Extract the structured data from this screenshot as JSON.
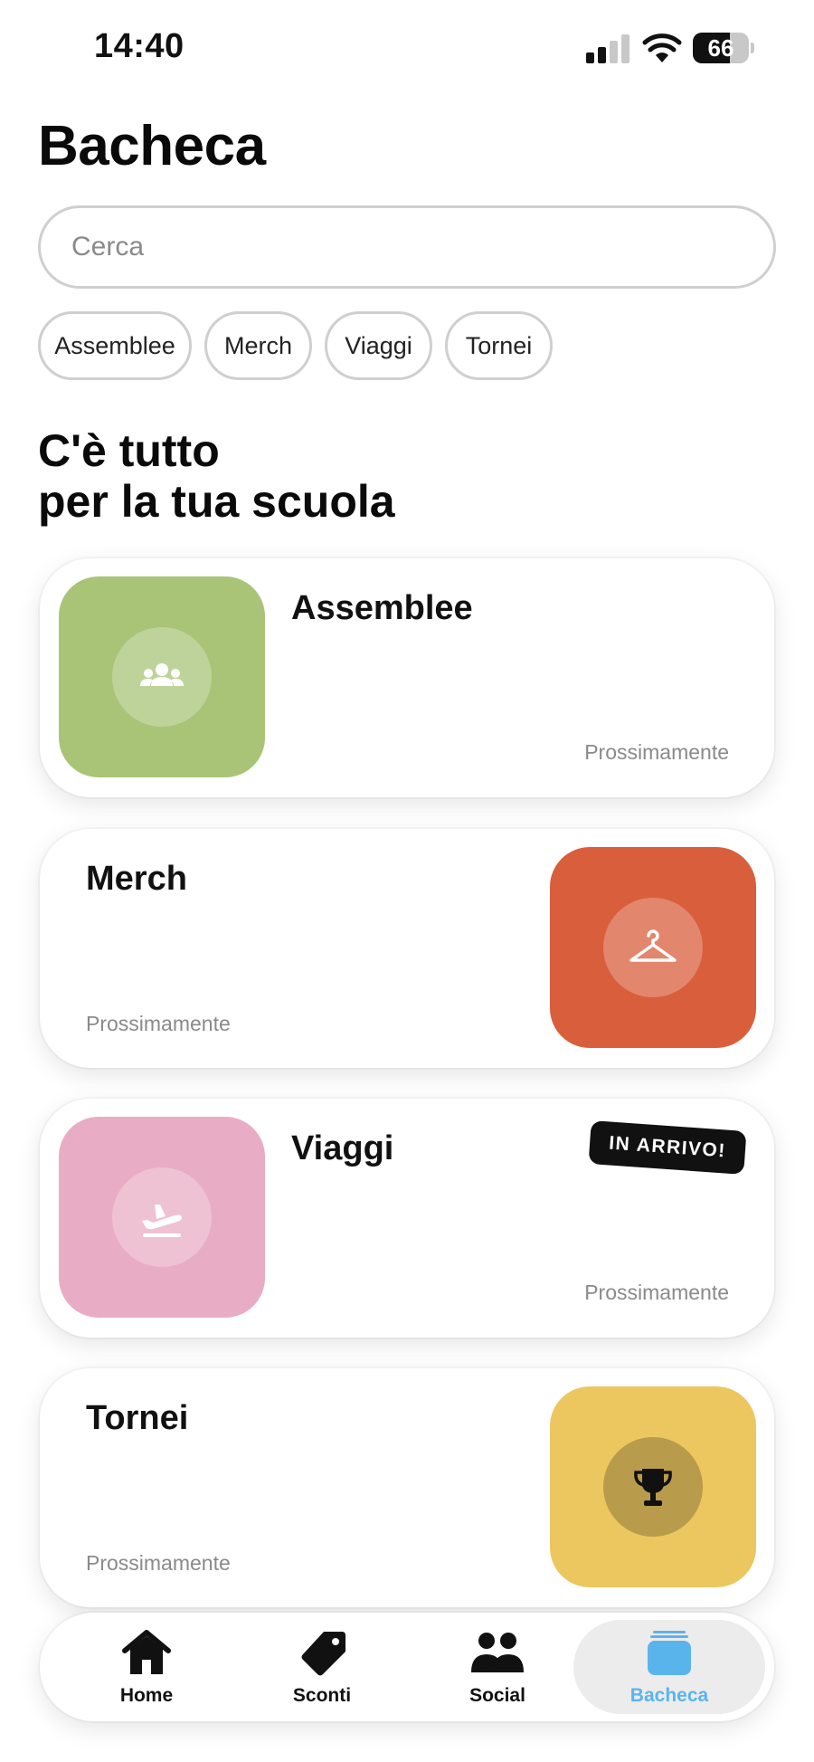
{
  "status_bar": {
    "time": "14:40",
    "battery": "66",
    "battery_level": 0.66
  },
  "header": {
    "title": "Bacheca"
  },
  "search": {
    "placeholder": "Cerca",
    "value": ""
  },
  "chips": [
    {
      "label": "Assemblee"
    },
    {
      "label": "Merch"
    },
    {
      "label": "Viaggi"
    },
    {
      "label": "Tornei"
    }
  ],
  "section": {
    "title_line1": "C'è tutto",
    "title_line2": "per la tua scuola"
  },
  "cards": [
    {
      "title": "Assemblee",
      "status": "Prossimamente",
      "color": "#a9c477",
      "icon": "people-icon"
    },
    {
      "title": "Merch",
      "status": "Prossimamente",
      "color": "#d95e3c",
      "icon": "hanger-icon"
    },
    {
      "title": "Viaggi",
      "status": "Prossimamente",
      "color": "#e8adc4",
      "icon": "airplane-icon",
      "badge": "IN ARRIVO!"
    },
    {
      "title": "Tornei",
      "status": "Prossimamente",
      "color": "#ecc760",
      "icon": "trophy-icon"
    }
  ],
  "nav": {
    "items": [
      {
        "label": "Home",
        "icon": "home-icon"
      },
      {
        "label": "Sconti",
        "icon": "tag-icon"
      },
      {
        "label": "Social",
        "icon": "people-icon"
      },
      {
        "label": "Bacheca",
        "icon": "cards-icon",
        "active": true
      }
    ],
    "active_color": "#5ab4ec"
  }
}
